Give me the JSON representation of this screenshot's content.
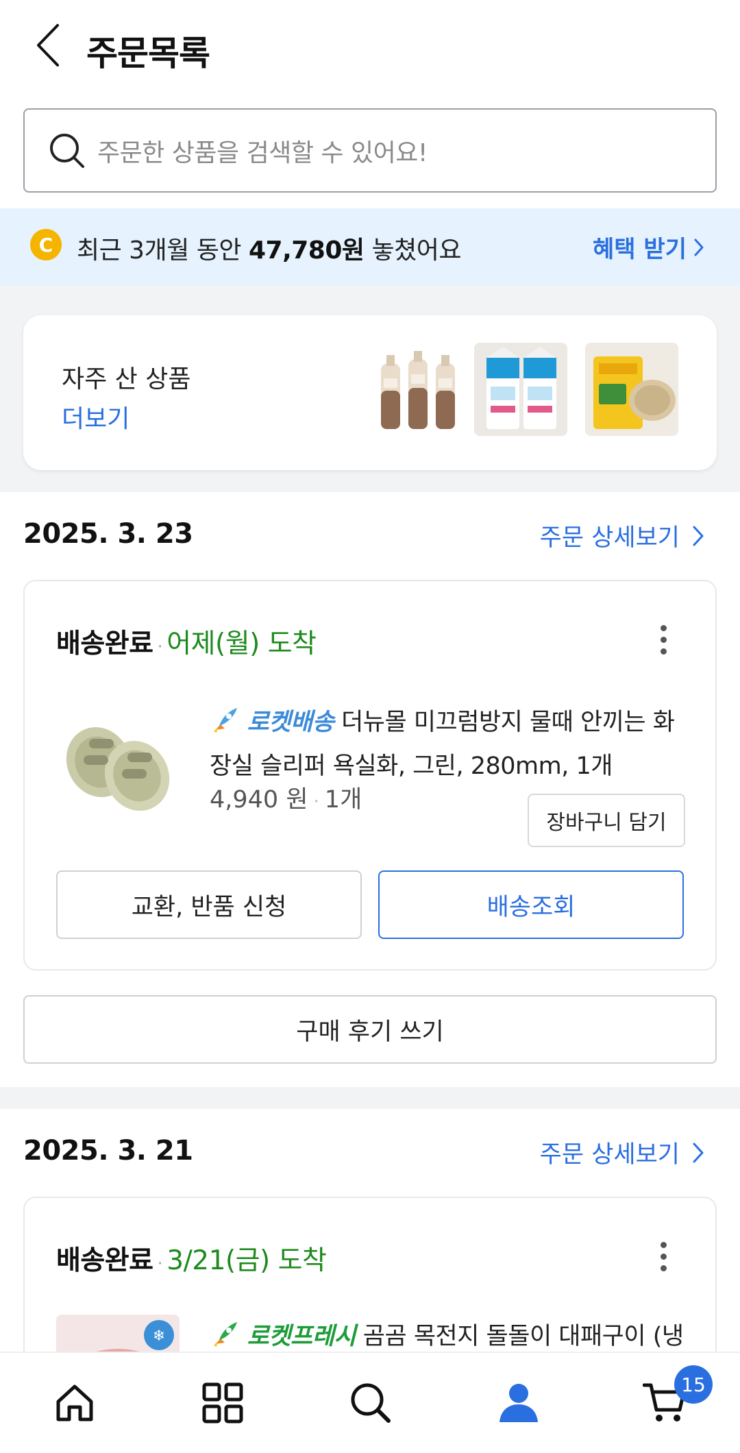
{
  "header": {
    "title": "주문목록"
  },
  "search": {
    "placeholder": "주문한 상품을 검색할 수 있어요!"
  },
  "benefit": {
    "coin_letter": "C",
    "text_before": "최근 3개월 동안 ",
    "amount": "47,780원",
    "text_after": " 놓쳤어요",
    "link_label": "혜택 받기"
  },
  "frequent": {
    "title": "자주 산 상품",
    "more_label": "더보기",
    "thumbnails": [
      "bottled-drinks",
      "milk-cartons",
      "grain-bag"
    ]
  },
  "orders": [
    {
      "date": "2025. 3. 23",
      "detail_label": "주문 상세보기",
      "status": "배송완료",
      "status_sep": "·",
      "arrival": "어제(월) 도착",
      "delivery_type": "로켓배송",
      "product_name": "더뉴몰 미끄럼방지 물때 안끼는 화장실 슬리퍼 욕실화, 그린, 280mm, 1개",
      "price": "4,940 원",
      "qty": "1개",
      "cart_label": "장바구니 담기",
      "exchange_label": "교환, 반품 신청",
      "track_label": "배송조회",
      "review_label": "구매 후기 쓰기"
    },
    {
      "date": "2025. 3. 21",
      "detail_label": "주문 상세보기",
      "status": "배송완료",
      "status_sep": "·",
      "arrival": "3/21(금) 도착",
      "delivery_type": "로켓프레시",
      "product_name": "곰곰 목전지 돌돌이 대패구이 (냉"
    }
  ],
  "nav": {
    "items": [
      "home-icon",
      "category-icon",
      "search-icon",
      "my-account-icon",
      "cart-icon"
    ],
    "cart_count": "15"
  },
  "colors": {
    "accent": "#2a6fe0",
    "arrival": "#1e8a1e",
    "banner_bg": "#e6f2fd",
    "badge": "#2a6fe0"
  }
}
